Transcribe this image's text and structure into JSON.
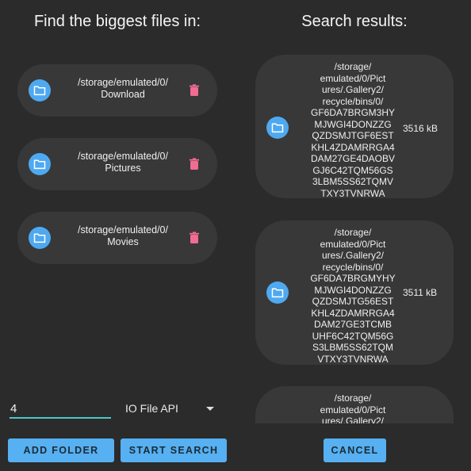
{
  "left_title": "Find the biggest files in:",
  "right_title": "Search results:",
  "folders": [
    {
      "path": "/storage/emulated/0/\nDownload"
    },
    {
      "path": "/storage/emulated/0/\nPictures"
    },
    {
      "path": "/storage/emulated/0/\nMovies"
    }
  ],
  "results": [
    {
      "path": "/storage/\nemulated/0/Pict\nures/.Gallery2/\nrecycle/bins/0/\nGF6DA7BRGM3HY\nMJWGI4DONZZG\nQZDSMJTGF6EST\nKHL4ZDAMRRGA4\nDAM27GE4DAOBV\nGJ6C42TQM56GS\n3LBM5SS62TQMV\nTXY3TVNRWA",
      "size": "3516 kB"
    },
    {
      "path": "/storage/\nemulated/0/Pict\nures/.Gallery2/\nrecycle/bins/0/\nGF6DA7BRGMYHY\nMJWGI4DONZZG\nQZDSMJTG56EST\nKHL4ZDAMRRGA4\nDAM27GE3TCMB\nUHF6C42TQM56G\nS3LBM5SS62TQM\nVTXY3TVNRWA",
      "size": "3511 kB"
    },
    {
      "path": "/storage/\nemulated/0/Pict\nures/.Gallery2/",
      "size": ""
    }
  ],
  "count_value": "4",
  "api_select": "IO File API",
  "buttons": {
    "add_folder": "ADD FOLDER",
    "start_search": "START SEARCH",
    "cancel": "CANCEL"
  },
  "colors": {
    "background": "#2b2b2b",
    "card": "#383838",
    "accent_blue": "#56b0f2",
    "trash_pink": "#f06c93",
    "input_underline": "#4ec6c8"
  }
}
